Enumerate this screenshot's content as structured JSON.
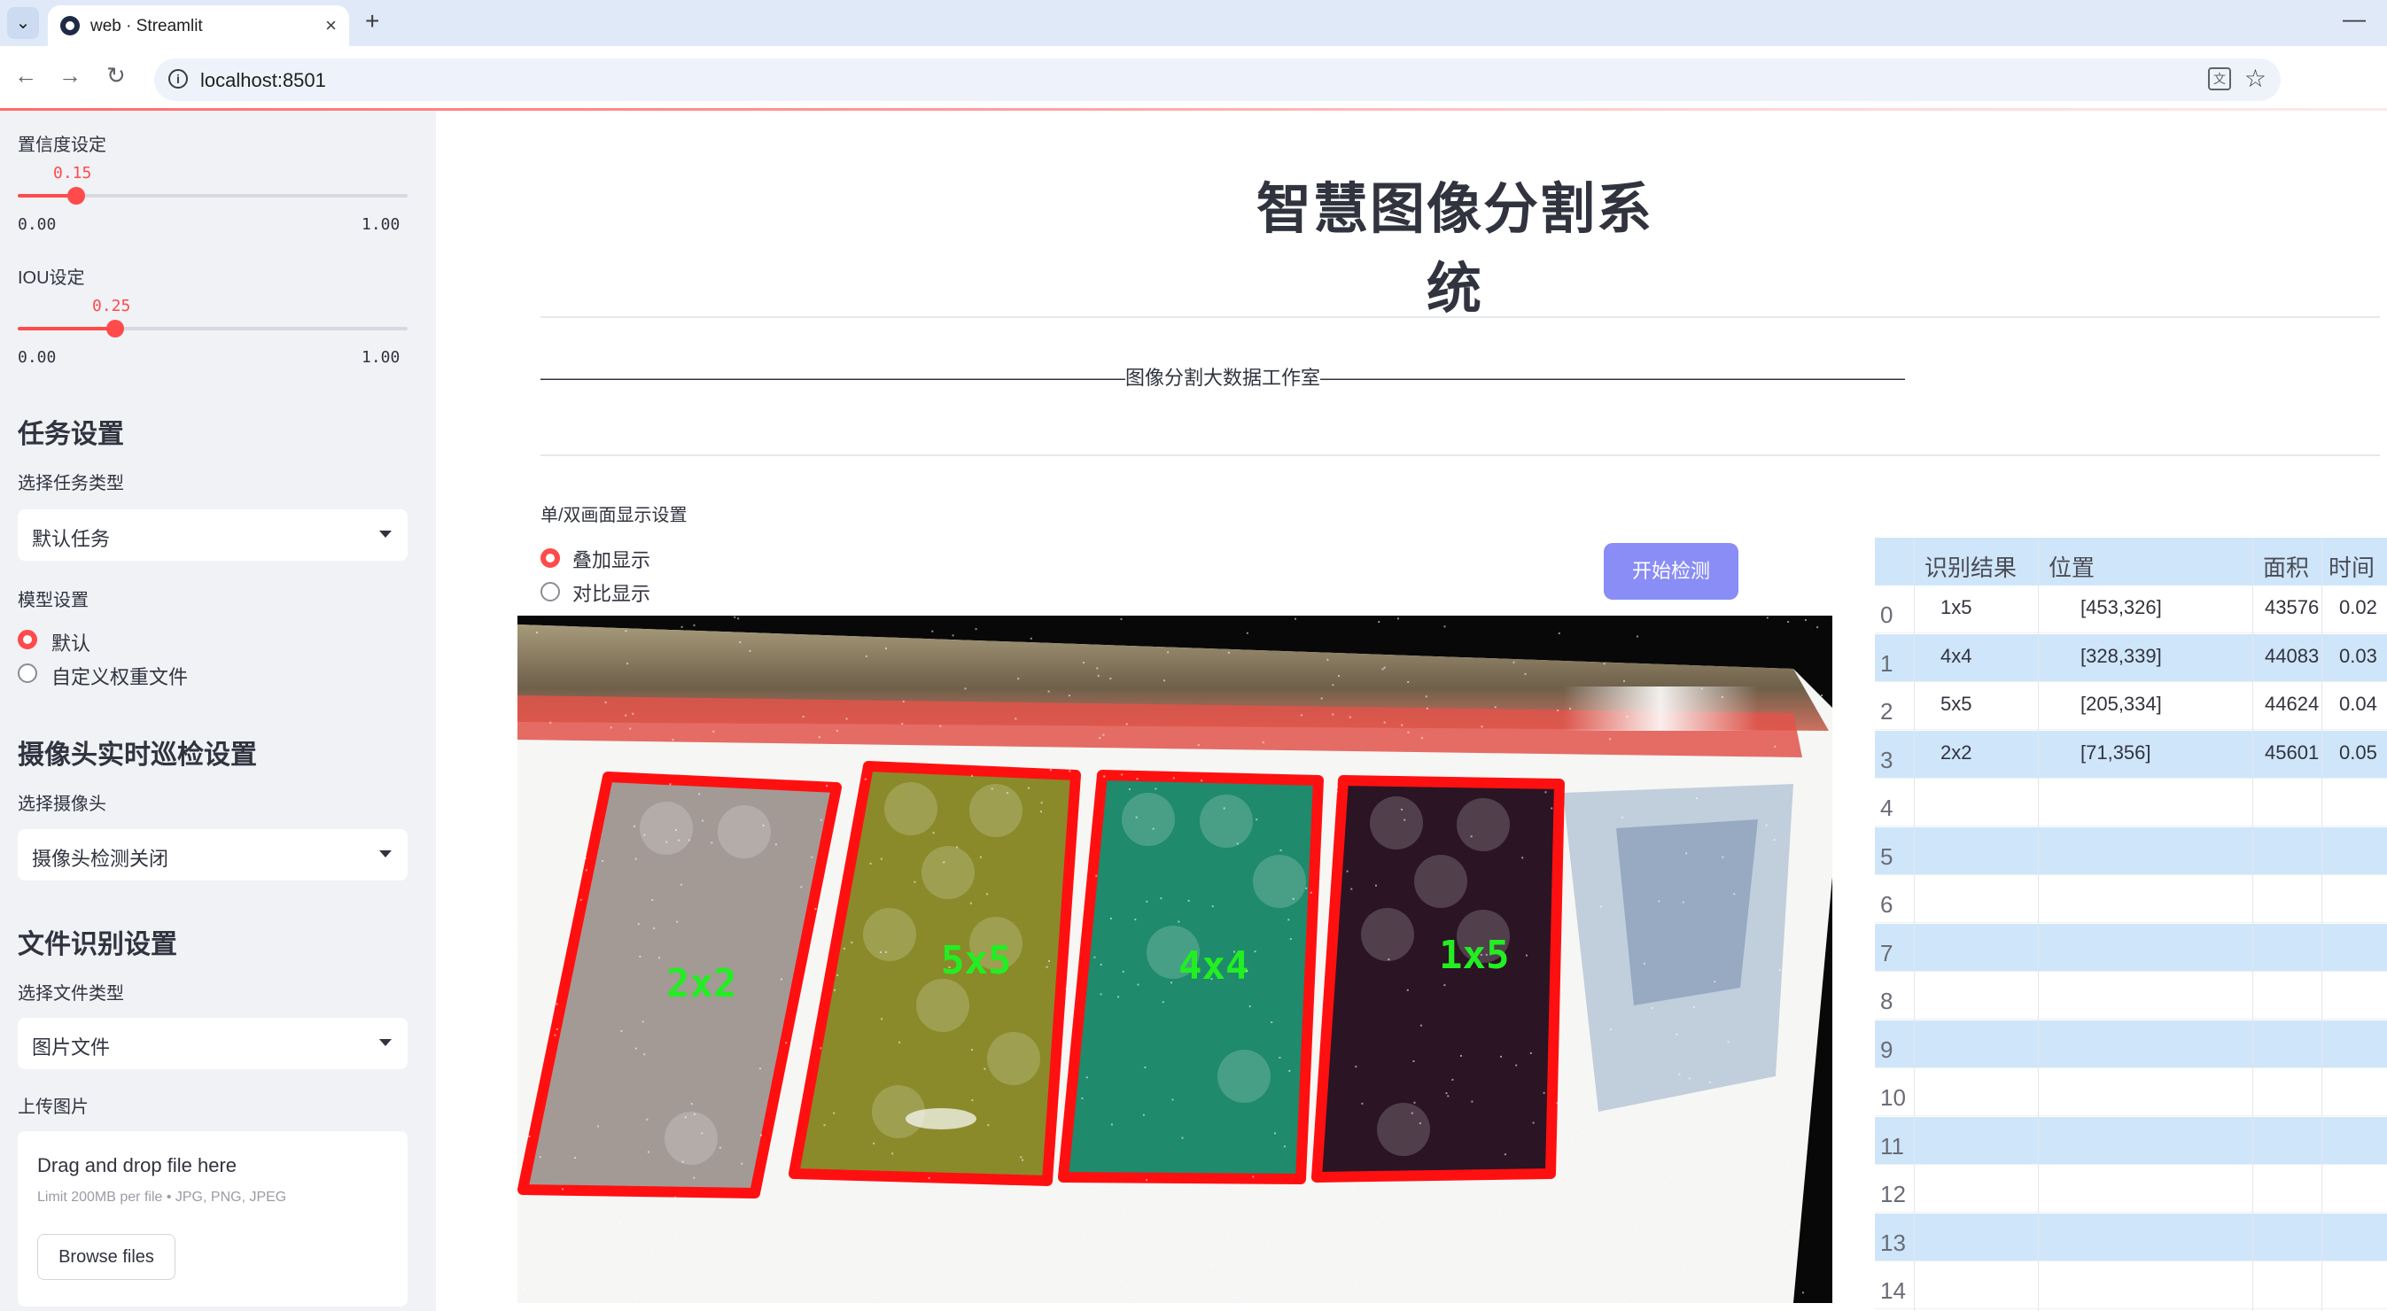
{
  "browser": {
    "tab_title": "web · Streamlit",
    "url": "localhost:8501"
  },
  "sidebar": {
    "conf_label": "置信度设定",
    "conf_value": "0.15",
    "conf_level": 0.15,
    "conf_min": "0.00",
    "conf_max": "1.00",
    "iou_label": "IOU设定",
    "iou_value": "0.25",
    "iou_level": 0.25,
    "iou_min": "0.00",
    "iou_max": "1.00",
    "task_heading": "任务设置",
    "task_type_label": "选择任务类型",
    "task_type_value": "默认任务",
    "model_label": "模型设置",
    "model_options": [
      "默认",
      "自定义权重文件"
    ],
    "camera_heading": "摄像头实时巡检设置",
    "camera_label": "选择摄像头",
    "camera_value": "摄像头检测关闭",
    "file_heading": "文件识别设置",
    "file_type_label": "选择文件类型",
    "file_type_value": "图片文件",
    "upload_label": "上传图片",
    "upload_title": "Drag and drop file here",
    "upload_limit": "Limit 200MB per file • JPG, PNG, JPEG",
    "browse_label": "Browse files"
  },
  "main": {
    "title": "智慧图像分割系统",
    "divider_text": "——————————————————————————————图像分割大数据工作室——————————————————————————————",
    "mode_label": "单/双画面显示设置",
    "mode_options": [
      "叠加显示",
      "对比显示"
    ],
    "detect_button": "开始检测",
    "detections": [
      "2x2",
      "5x5",
      "4x4",
      "1x5"
    ]
  },
  "table": {
    "headers": [
      "识别结果",
      "位置",
      "面积",
      "时间"
    ],
    "rows": [
      {
        "index": "0",
        "result": "1x5",
        "pos": "[453,326]",
        "area": "43576",
        "time": "0.02"
      },
      {
        "index": "1",
        "result": "4x4",
        "pos": "[328,339]",
        "area": "44083",
        "time": "0.03"
      },
      {
        "index": "2",
        "result": "5x5",
        "pos": "[205,334]",
        "area": "44624",
        "time": "0.04"
      },
      {
        "index": "3",
        "result": "2x2",
        "pos": "[71,356]",
        "area": "45601",
        "time": "0.05"
      },
      {
        "index": "4"
      },
      {
        "index": "5"
      },
      {
        "index": "6"
      },
      {
        "index": "7"
      },
      {
        "index": "8"
      },
      {
        "index": "9"
      },
      {
        "index": "10"
      },
      {
        "index": "11"
      },
      {
        "index": "12"
      },
      {
        "index": "13"
      },
      {
        "index": "14"
      }
    ]
  },
  "colors": {
    "accent": "#ff4b4b",
    "button": "#8a8df5",
    "table_stripe": "#cfe6fa",
    "sidebar_bg": "#f0f2f6",
    "detection_box": "#ff1010",
    "detection_label": "#22ee22"
  }
}
